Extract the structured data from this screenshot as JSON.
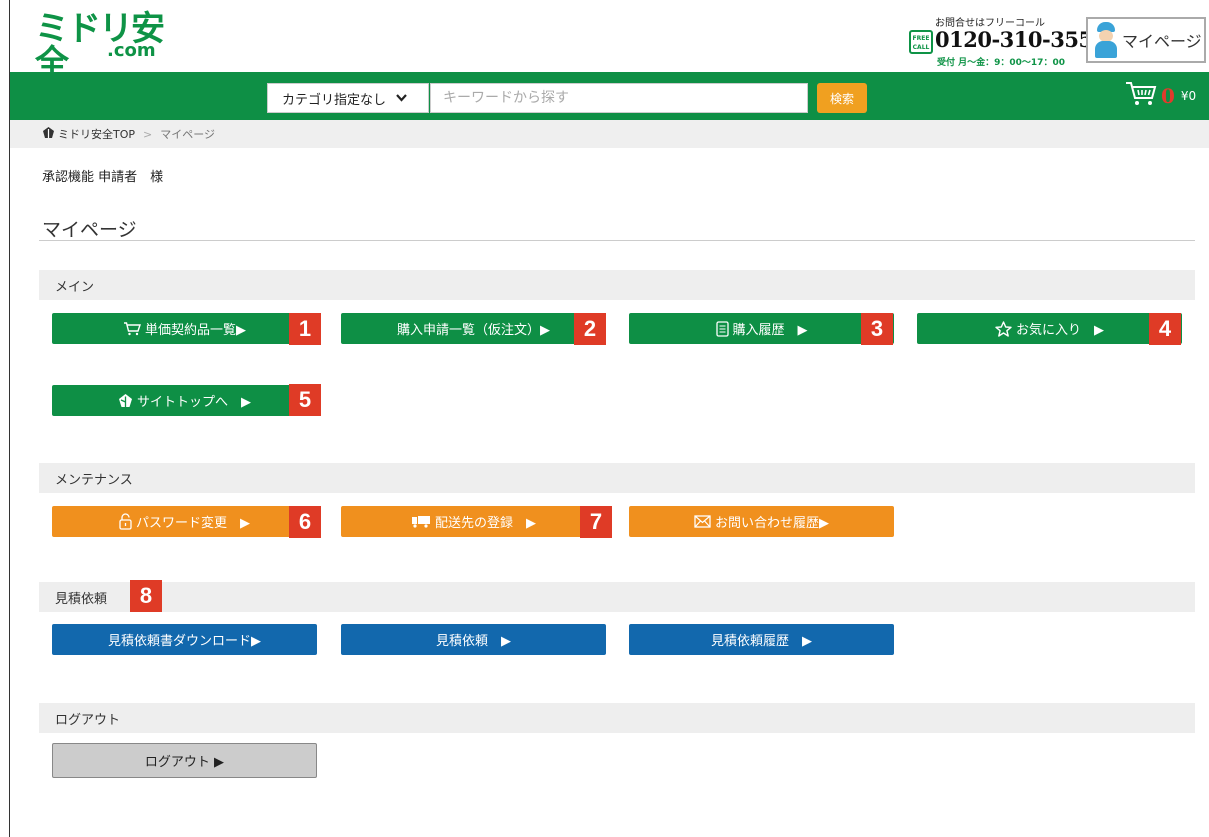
{
  "header": {
    "logo_main": "ミドリ安全",
    "logo_sub": ".com",
    "tel_note": "お問合せはフリーコール",
    "tel_badge": "FREE CALL",
    "tel_number": "0120-310-355",
    "tel_hours": "受付 月〜金：9：00〜17：00",
    "mypage_label": "マイページ"
  },
  "search": {
    "category_label": "カテゴリ指定なし",
    "keyword_placeholder": "キーワードから探す",
    "keyword_value": "",
    "search_label": "検索"
  },
  "cart": {
    "count": "0",
    "price": "¥0"
  },
  "breadcrumb": {
    "home": "ミドリ安全TOP",
    "separator": ">",
    "current": "マイページ"
  },
  "user_line": "承認機能 申請者　様",
  "page_title": "マイページ",
  "sections": {
    "main": {
      "heading": "メイン",
      "buttons": [
        {
          "label": "単価契約品一覧▶",
          "icon": "cart-icon",
          "badge": "1"
        },
        {
          "label": "購入申請一覧（仮注文）▶",
          "icon": "",
          "badge": "2"
        },
        {
          "label": "購入履歴　▶",
          "icon": "document-icon",
          "badge": "3"
        },
        {
          "label": "お気に入り　▶",
          "icon": "star-icon",
          "badge": "4"
        },
        {
          "label": "サイトトップへ　▶",
          "icon": "home-icon",
          "badge": "5"
        }
      ]
    },
    "maintenance": {
      "heading": "メンテナンス",
      "buttons": [
        {
          "label": "パスワード変更　▶",
          "icon": "lock-icon",
          "badge": "6"
        },
        {
          "label": "配送先の登録　▶",
          "icon": "truck-icon",
          "badge": "7"
        },
        {
          "label": "お問い合わせ履歴▶",
          "icon": "mail-icon",
          "badge": ""
        }
      ]
    },
    "estimate": {
      "heading": "見積依頼",
      "heading_badge": "8",
      "buttons": [
        {
          "label": "見積依頼書ダウンロード▶"
        },
        {
          "label": "見積依頼　▶"
        },
        {
          "label": "見積依頼履歴　▶"
        }
      ]
    },
    "logout": {
      "heading": "ログアウト",
      "button_label": "ログアウト ▶"
    }
  },
  "colors": {
    "brand_green": "#0e8f45",
    "orange": "#f0901e",
    "blue": "#1268ad",
    "badge_red": "#df3b26"
  }
}
